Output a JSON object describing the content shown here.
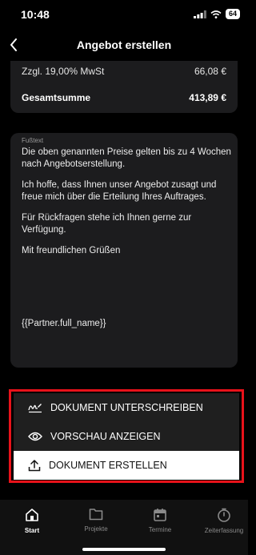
{
  "status": {
    "time": "10:48",
    "battery": "64"
  },
  "header": {
    "title": "Angebot erstellen"
  },
  "totals": {
    "tax_label": "Zzgl. 19,00% MwSt",
    "tax_value": "66,08 €",
    "sum_label": "Gesamtsumme",
    "sum_value": "413,89 €"
  },
  "footer": {
    "label": "Fußtext",
    "paragraphs": [
      "Die oben genannten Preise gelten bis zu 4 Wochen nach Angebotserstellung.",
      "Ich hoffe, dass Ihnen unser Angebot zusagt und freue mich über die Erteilung Ihres Auftrages.",
      "Für Rückfragen stehe ich Ihnen gerne zur Verfügung.",
      "Mit freundlichen Grüßen"
    ],
    "partner": "{{Partner.full_name}}"
  },
  "actions": {
    "sign": "DOKUMENT UNTERSCHREIBEN",
    "preview": "VORSCHAU ANZEIGEN",
    "create": "DOKUMENT ERSTELLEN"
  },
  "tabs": [
    {
      "label": "Start",
      "icon": "home-icon"
    },
    {
      "label": "Projekte",
      "icon": "folder-icon"
    },
    {
      "label": "Termine",
      "icon": "calendar-icon"
    },
    {
      "label": "Zeiterfassung",
      "icon": "timer-icon"
    }
  ],
  "colors": {
    "highlight": "#e8121a",
    "card": "#1c1c1e"
  }
}
